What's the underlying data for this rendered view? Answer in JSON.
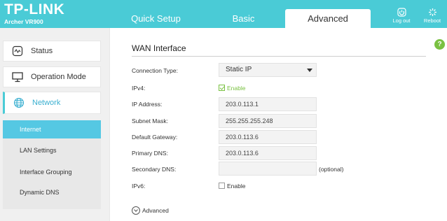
{
  "brand": {
    "logo": "TP-LINK",
    "model": "Archer VR900"
  },
  "nav": {
    "tabs": [
      {
        "label": "Quick Setup"
      },
      {
        "label": "Basic"
      },
      {
        "label": "Advanced",
        "active": true
      }
    ],
    "logout_label": "Log out",
    "reboot_label": "Reboot",
    "logout_icon": "logout-icon",
    "reboot_icon": "reboot-icon"
  },
  "sidebar": {
    "items": [
      {
        "label": "Status",
        "icon": "status-icon"
      },
      {
        "label": "Operation Mode",
        "icon": "monitor-icon"
      },
      {
        "label": "Network",
        "icon": "globe-icon",
        "active": true
      }
    ],
    "subitems": [
      {
        "label": "Internet",
        "active": true
      },
      {
        "label": "LAN Settings"
      },
      {
        "label": "Interface Grouping"
      },
      {
        "label": "Dynamic DNS"
      }
    ]
  },
  "main": {
    "title": "WAN Interface",
    "help_label": "?",
    "connection_type": {
      "label": "Connection Type:",
      "value": "Static IP"
    },
    "ipv4": {
      "label": "IPv4:",
      "checkbox_label": "Enable",
      "checked": true
    },
    "ip_address": {
      "label": "IP Address:",
      "value": "203.0.113.1"
    },
    "subnet_mask": {
      "label": "Subnet Mask:",
      "value": "255.255.255.248"
    },
    "default_gateway": {
      "label": "Default Gateway:",
      "value": "203.0.113.6"
    },
    "primary_dns": {
      "label": "Primary DNS:",
      "value": "203.0.113.6"
    },
    "secondary_dns": {
      "label": "Secondary DNS:",
      "value": "",
      "note": "(optional)"
    },
    "ipv6": {
      "label": "IPv6:",
      "checkbox_label": "Enable",
      "checked": false
    },
    "advanced_toggle": "Advanced"
  },
  "colors": {
    "header": "#4acbd6",
    "active_submenu": "#55c8e3",
    "accent_green": "#7ac142"
  }
}
